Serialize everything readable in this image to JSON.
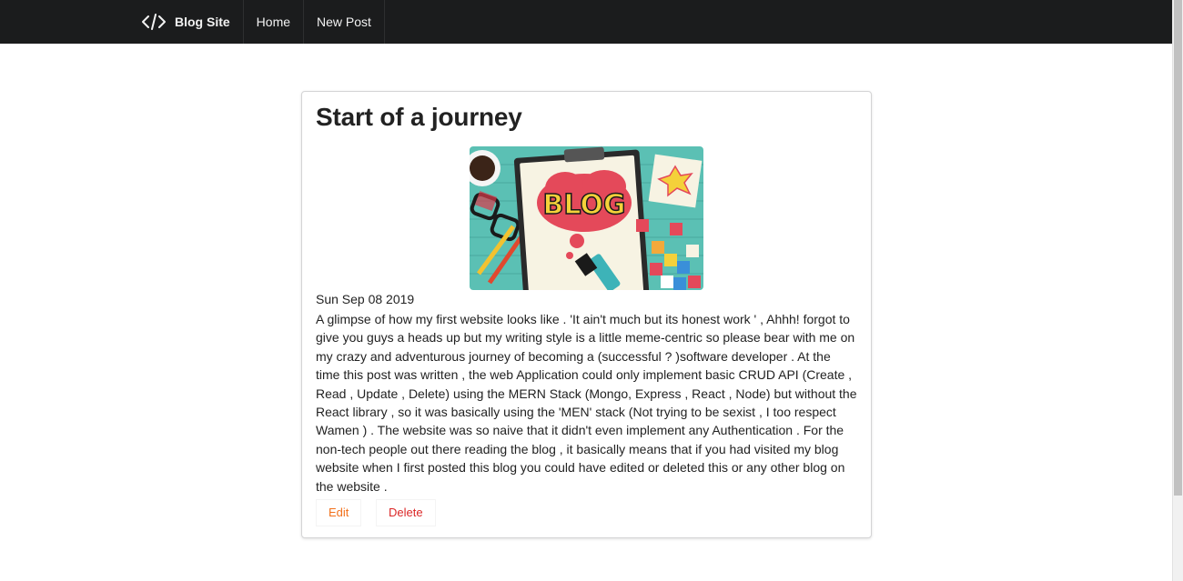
{
  "navbar": {
    "brand_icon": "code-icon",
    "brand_label": "Blog Site",
    "items": [
      {
        "label": "Home"
      },
      {
        "label": "New Post"
      }
    ]
  },
  "post": {
    "title": "Start of a journey",
    "image_alt_icon": "blog-illustration",
    "date": "Sun Sep 08 2019",
    "body": "A glimpse of how my first website looks like . 'It ain't much but its honest work ' , Ahhh! forgot to give you guys a heads up but my writing style is a little meme-centric so please bear with me on my crazy and adventurous journey of becoming a (successful ? )software developer . At the time this post was written , the web Application could only implement basic CRUD API (Create , Read , Update , Delete) using the MERN Stack (Mongo, Express , React , Node) but without the React library , so it was basically using the 'MEN' stack (Not trying to be sexist , I too respect Wamen ) . The website was so naive that it didn't even implement any Authentication . For the non-tech people out there reading the blog , it basically means that if you had visited my blog website when I first posted this blog you could have edited or deleted this or any other blog on the website .",
    "image_text": "BLOG",
    "actions": {
      "edit_label": "Edit",
      "delete_label": "Delete"
    }
  },
  "colors": {
    "navbar_bg": "#1b1c1d",
    "edit": "#f2711c",
    "delete": "#db2828",
    "image_bg": "#5bc0b4"
  }
}
